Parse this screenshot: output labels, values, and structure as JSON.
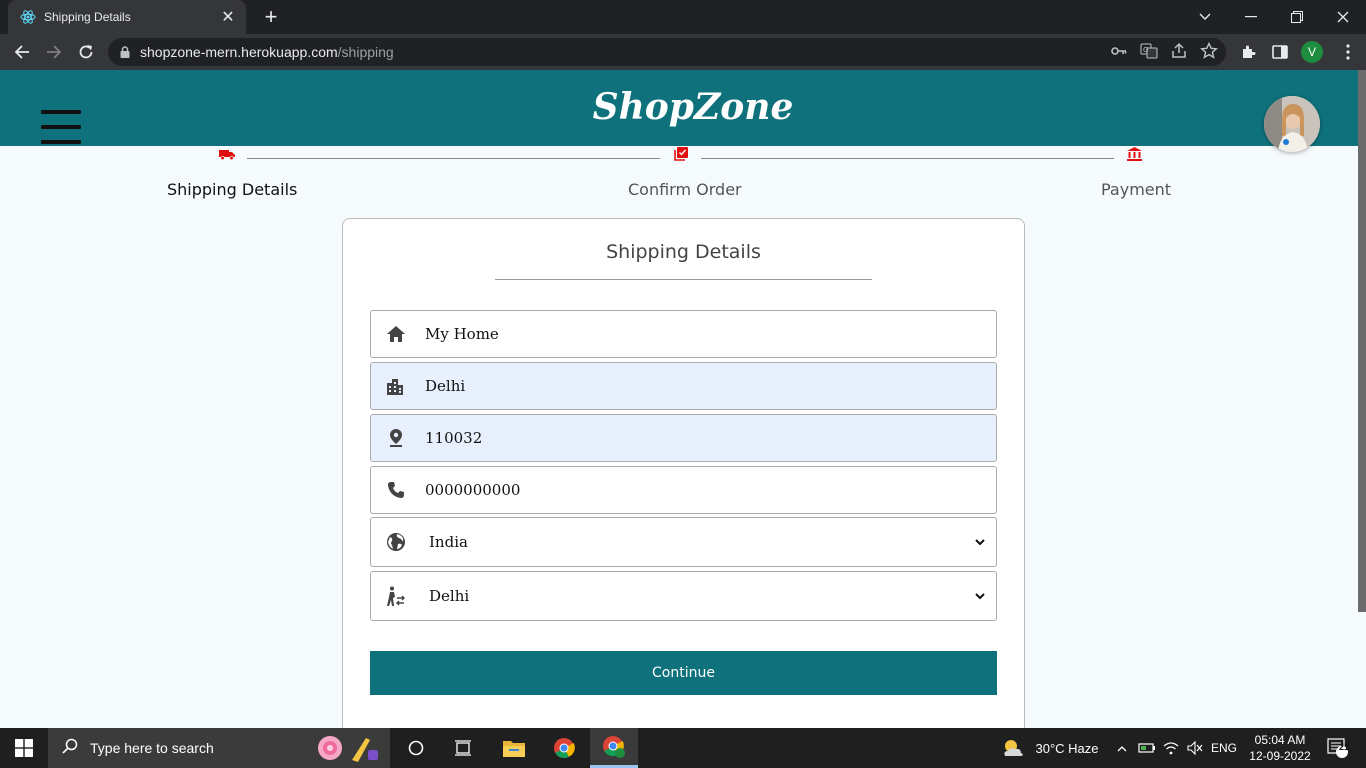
{
  "browser": {
    "tab_title": "Shipping Details",
    "tab_close": "✕",
    "new_tab": "+",
    "url_host": "shopzone-mern.herokuapp.com",
    "url_path": "/shipping",
    "profile_letter": "V"
  },
  "site": {
    "logo": "ShopZone"
  },
  "stepper": {
    "steps": [
      {
        "label": "Shipping Details",
        "icon": "truck-icon",
        "active": true
      },
      {
        "label": "Confirm Order",
        "icon": "checklist-icon",
        "active": false
      },
      {
        "label": "Payment",
        "icon": "bank-icon",
        "active": false
      }
    ],
    "icon_color": "#e01010"
  },
  "form": {
    "title": "Shipping Details",
    "address": "My Home",
    "city": "Delhi",
    "pincode": "110032",
    "phone": "0000000000",
    "country": "India",
    "state": "Delhi",
    "continue_label": "Continue"
  },
  "taskbar": {
    "search_placeholder": "Type here to search",
    "weather": "30°C  Haze",
    "language": "ENG",
    "time": "05:04 AM",
    "date": "12-09-2022",
    "notifications": "21"
  },
  "colors": {
    "brand": "#0e717c",
    "autofill": "#e8f0fe"
  }
}
